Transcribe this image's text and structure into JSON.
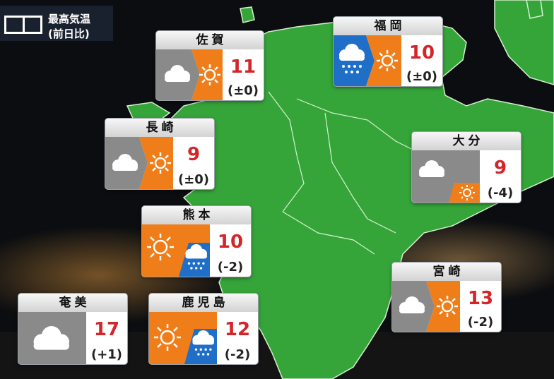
{
  "legend": {
    "line1": "最高気温",
    "line2": "(前日比)"
  },
  "cities": [
    {
      "name": "佐賀",
      "high": "11",
      "diff": "(±0)",
      "icon_a": "cloud-icon",
      "icon_b": "sun-icon"
    },
    {
      "name": "福岡",
      "high": "10",
      "diff": "(±0)",
      "icon_a": "rain-icon",
      "icon_b": "sun-icon"
    },
    {
      "name": "長崎",
      "high": "9",
      "diff": "(±0)",
      "icon_a": "cloud-icon",
      "icon_b": "sun-icon"
    },
    {
      "name": "大分",
      "high": "9",
      "diff": "(-4)",
      "icon_a": "cloud-icon",
      "icon_b": "sun-icon"
    },
    {
      "name": "熊本",
      "high": "10",
      "diff": "(-2)",
      "icon_a": "sun-icon",
      "icon_b": "rain-icon"
    },
    {
      "name": "宮崎",
      "high": "13",
      "diff": "(-2)",
      "icon_a": "cloud-icon",
      "icon_b": "sun-icon"
    },
    {
      "name": "奄美",
      "high": "17",
      "diff": "(+1)",
      "icon_a": "cloud-icon"
    },
    {
      "name": "鹿児島",
      "high": "12",
      "diff": "(-2)",
      "icon_a": "sun-icon",
      "icon_b": "rain-icon"
    }
  ],
  "colors": {
    "land": "#35a53a",
    "land_border": "#d7f0d0",
    "sea": "#0b0d10",
    "cloud_bg": "#8a8a8a",
    "sun_bg": "#ef7d1a",
    "rain_bg": "#1f6fc8",
    "temp_text": "#d4262a"
  }
}
